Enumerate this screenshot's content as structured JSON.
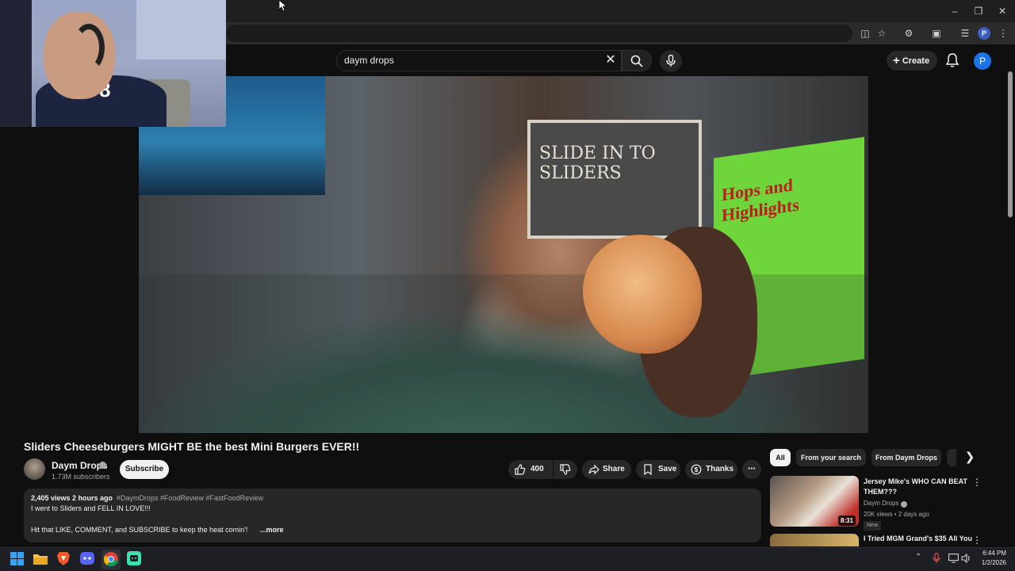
{
  "masthead": {
    "search_value": "daym drops",
    "create_label": "Create",
    "avatar_initial": "P"
  },
  "browser": {
    "profile_initial": "P"
  },
  "video": {
    "title": "Sliders Cheeseburgers MIGHT BE the best Mini Burgers EVER!!",
    "sign_text": "SLIDE IN TO SLIDERS",
    "poster_text": "Hops and Highlights"
  },
  "webcam": {
    "jersey_number": "8"
  },
  "channel": {
    "name": "Daym Drops",
    "subscribers": "1.73M subscribers",
    "subscribe_label": "Subscribe"
  },
  "actions": {
    "like_count": "400",
    "share_label": "Share",
    "save_label": "Save",
    "thanks_label": "Thanks"
  },
  "description": {
    "meta": "2,405 views  2 hours ago",
    "hashtags": "#DaymDrops #FoodReview #FastFoodReview",
    "line1": "I went to Sliders and FELL IN LOVE!!!",
    "line2": "Hit that LIKE, COMMENT, and SUBSCRIBE to keep the heat comin'!",
    "more_label": "...more"
  },
  "sidebar": {
    "chips": [
      "All",
      "From your search",
      "From Daym Drops"
    ],
    "recommendations": [
      {
        "title": "Jersey Mike's WHO CAN BEAT THEM???",
        "channel": "Daym Drops",
        "meta": "20K views • 2 days ago",
        "badge": "New",
        "duration": "8:31"
      },
      {
        "title": "I Tried MGM Grand's $35 All You"
      }
    ]
  },
  "taskbar": {
    "time": "6:44 PM",
    "date": "1/2/2026"
  },
  "colors": {
    "background": "#0f0f0f",
    "surface": "#272727",
    "accent_avatar": "#1a73e8",
    "poster_green": "#6ed63a"
  }
}
